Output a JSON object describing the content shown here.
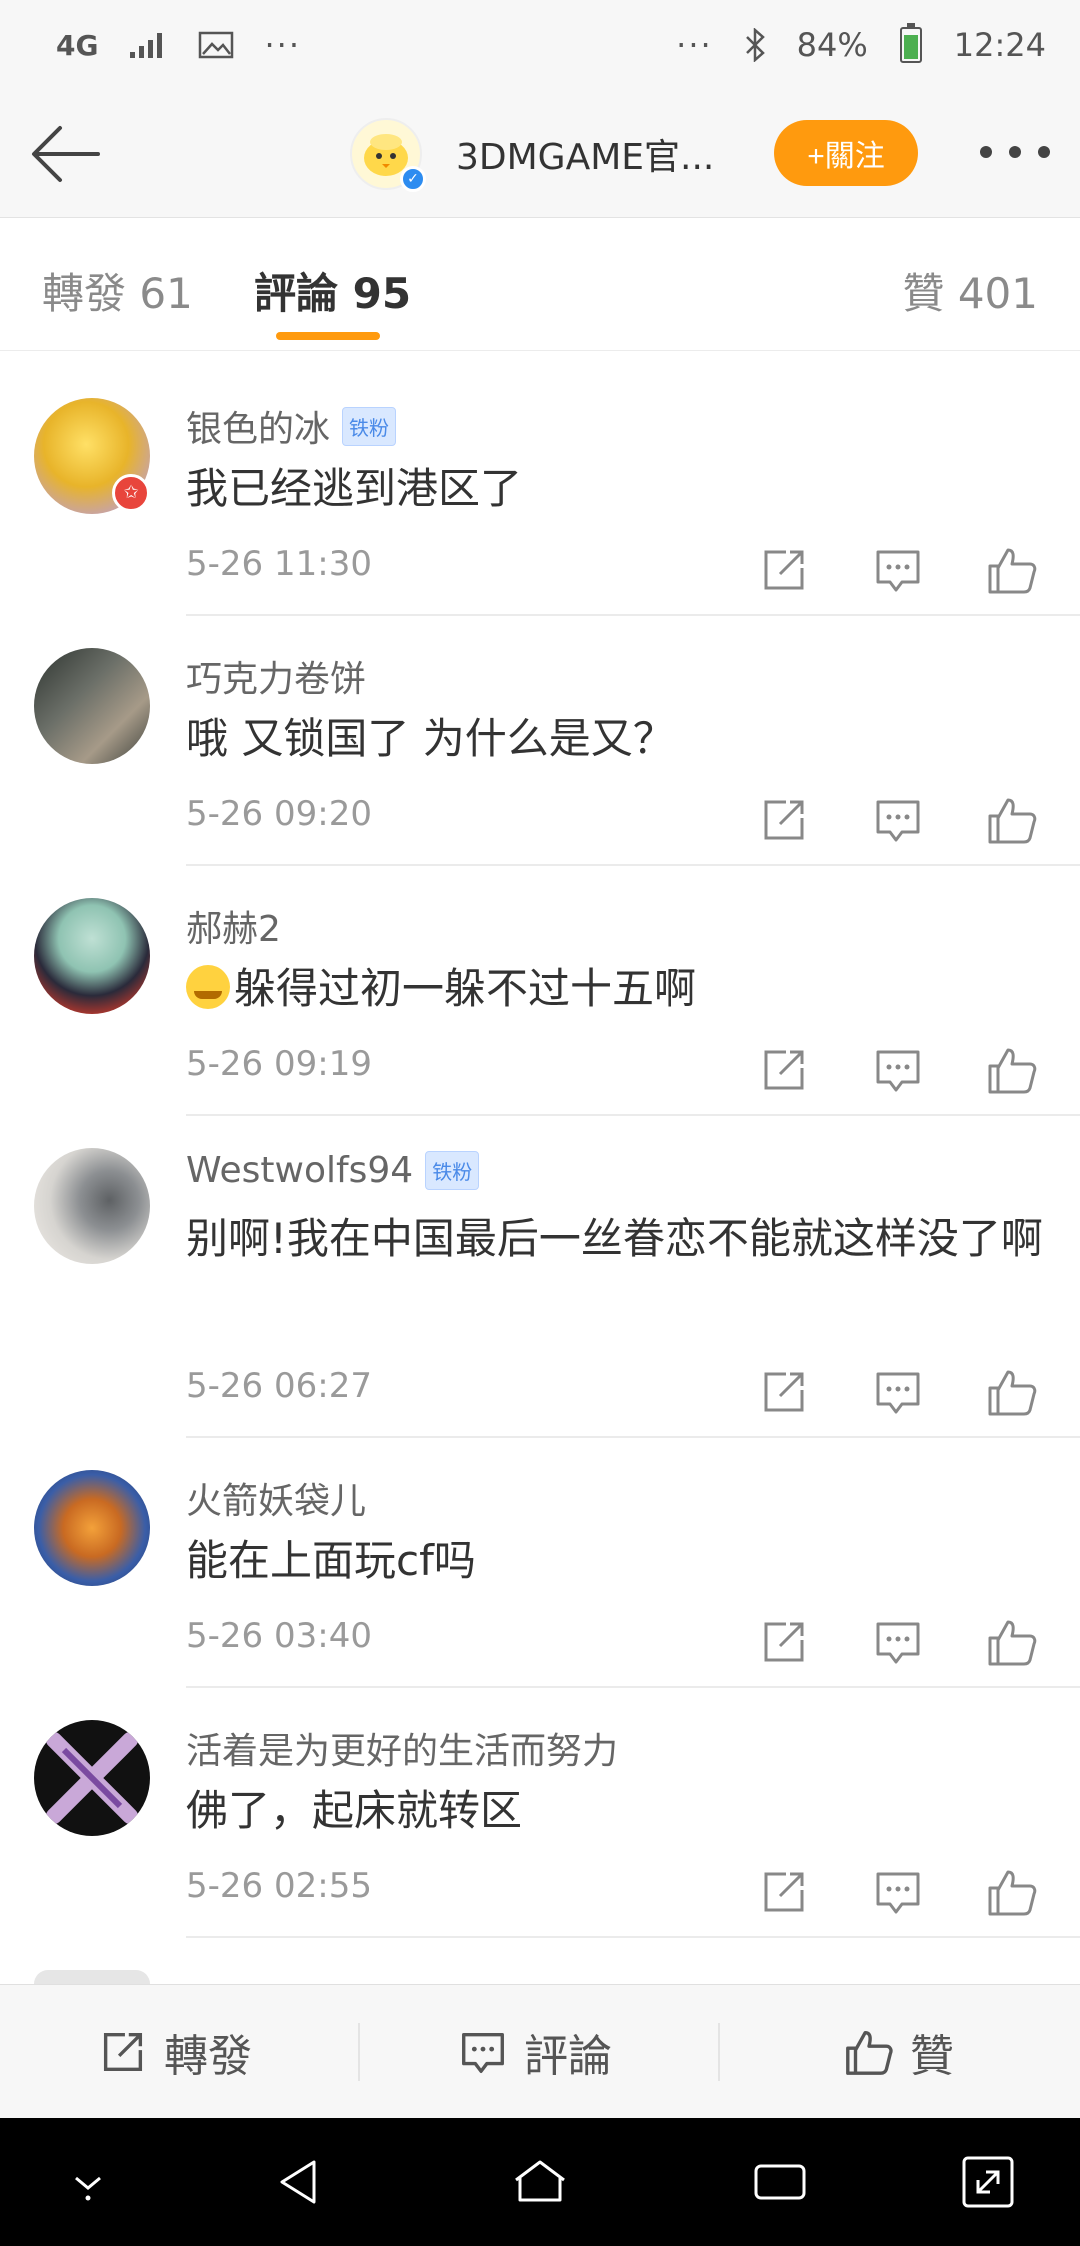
{
  "status_bar": {
    "network": "4G",
    "dots_left": "···",
    "dots_right": "···",
    "battery": "84%",
    "time": "12:24"
  },
  "header": {
    "title": "3DMGAME官...",
    "follow_label": "+關注"
  },
  "tabs": {
    "reposts": "轉發 61",
    "comments": "評論 95",
    "likes": "贊 401"
  },
  "comments": [
    {
      "author": "银色的冰",
      "badge": "铁粉",
      "text": "我已经逃到港区了",
      "time": "5-26 11:30"
    },
    {
      "author": "巧克力卷饼",
      "badge": "",
      "text": "哦 又锁国了 为什么是又？",
      "time": "5-26 09:20"
    },
    {
      "author": "郝赫2",
      "badge": "",
      "text": "躲得过初一躲不过十五啊",
      "time": "5-26 09:19"
    },
    {
      "author": "Westwolfs94",
      "badge": "铁粉",
      "text": "别啊!我在中国最后一丝眷恋不能就这样没了啊",
      "time": "5-26 06:27"
    },
    {
      "author": "火箭妖袋儿",
      "badge": "",
      "text": "能在上面玩cf吗",
      "time": "5-26 03:40"
    },
    {
      "author": "活着是为更好的生活而努力",
      "badge": "",
      "text": "佛了，起床就转区",
      "time": "5-26 02:55"
    }
  ],
  "bottom_bar": {
    "repost": "轉發",
    "comment": "評論",
    "like": "贊"
  },
  "colors": {
    "accent": "#ff9a0e",
    "badge": "#4a8ae8"
  },
  "icons": [
    "back-arrow-icon",
    "more-icon",
    "share-icon",
    "reply-icon",
    "thumbs-up-icon",
    "home-icon",
    "recents-icon",
    "back-icon",
    "expand-icon",
    "down-icon"
  ]
}
